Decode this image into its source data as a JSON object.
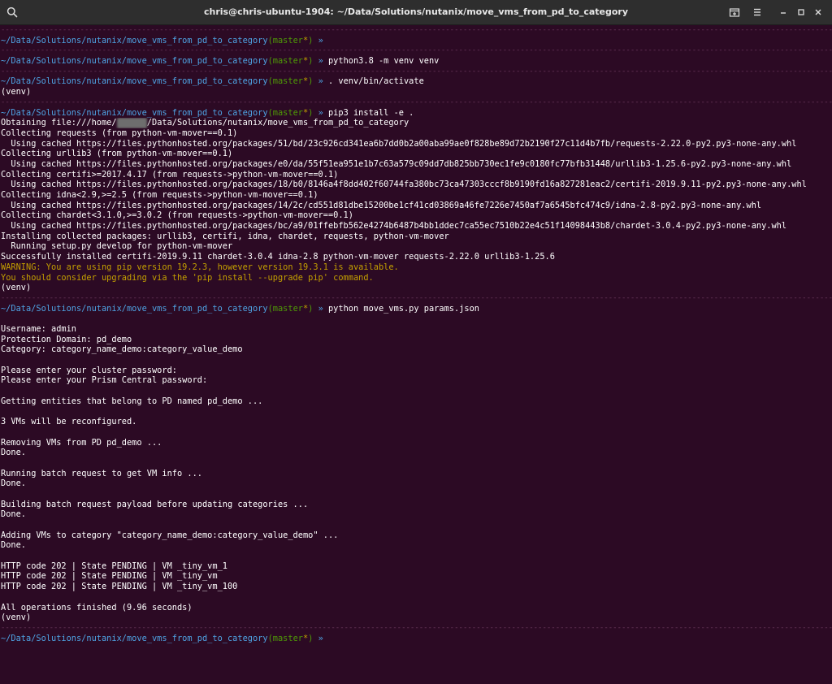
{
  "window": {
    "title": "chris@chris-ubuntu-1904: ~/Data/Solutions/nutanix/move_vms_from_pd_to_category",
    "icons": {
      "search": "search-icon",
      "new_tab": "new-tab-icon",
      "menu": "hamburger-menu-icon",
      "minimize": "minimize-icon",
      "maximize": "maximize-icon",
      "close": "close-icon"
    }
  },
  "colors": {
    "background": "#2c0a24",
    "foreground": "#ffffff",
    "prompt_path": "#4ea3e3",
    "prompt_branch": "#4e9a06",
    "warning": "#c4a000"
  },
  "prompt": {
    "path": "~/Data/Solutions/nutanix/move_vms_from_pd_to_category",
    "open_paren": "(",
    "branch": "master",
    "dirty": "*",
    "close_paren": ")",
    "arrow": " » "
  },
  "separator": "------------------------------------------------------------------------------------------------------------------------------------------------------------------------------------------------------------------------------------",
  "lines": [
    {
      "type": "sep"
    },
    {
      "type": "prompt",
      "cmd": ""
    },
    {
      "type": "sep"
    },
    {
      "type": "prompt",
      "cmd": "python3.8 -m venv venv"
    },
    {
      "type": "sep"
    },
    {
      "type": "prompt",
      "cmd": ". venv/bin/activate"
    },
    {
      "type": "text",
      "text": "(venv)"
    },
    {
      "type": "sep"
    },
    {
      "type": "prompt",
      "cmd": "pip3 install -e ."
    },
    {
      "type": "obtaining",
      "before": "Obtaining file:///home/",
      "redacted": "XXXXXX",
      "after": "/Data/Solutions/nutanix/move_vms_from_pd_to_category"
    },
    {
      "type": "text",
      "text": "Collecting requests (from python-vm-mover==0.1)"
    },
    {
      "type": "text",
      "text": "  Using cached https://files.pythonhosted.org/packages/51/bd/23c926cd341ea6b7dd0b2a00aba99ae0f828be89d72b2190f27c11d4b7fb/requests-2.22.0-py2.py3-none-any.whl"
    },
    {
      "type": "text",
      "text": "Collecting urllib3 (from python-vm-mover==0.1)"
    },
    {
      "type": "text",
      "text": "  Using cached https://files.pythonhosted.org/packages/e0/da/55f51ea951e1b7c63a579c09dd7db825bb730ec1fe9c0180fc77bfb31448/urllib3-1.25.6-py2.py3-none-any.whl"
    },
    {
      "type": "text",
      "text": "Collecting certifi>=2017.4.17 (from requests->python-vm-mover==0.1)"
    },
    {
      "type": "text",
      "text": "  Using cached https://files.pythonhosted.org/packages/18/b0/8146a4f8dd402f60744fa380bc73ca47303cccf8b9190fd16a827281eac2/certifi-2019.9.11-py2.py3-none-any.whl"
    },
    {
      "type": "text",
      "text": "Collecting idna<2.9,>=2.5 (from requests->python-vm-mover==0.1)"
    },
    {
      "type": "text",
      "text": "  Using cached https://files.pythonhosted.org/packages/14/2c/cd551d81dbe15200be1cf41cd03869a46fe7226e7450af7a6545bfc474c9/idna-2.8-py2.py3-none-any.whl"
    },
    {
      "type": "text",
      "text": "Collecting chardet<3.1.0,>=3.0.2 (from requests->python-vm-mover==0.1)"
    },
    {
      "type": "text",
      "text": "  Using cached https://files.pythonhosted.org/packages/bc/a9/01ffebfb562e4274b6487b4bb1ddec7ca55ec7510b22e4c51f14098443b8/chardet-3.0.4-py2.py3-none-any.whl"
    },
    {
      "type": "text",
      "text": "Installing collected packages: urllib3, certifi, idna, chardet, requests, python-vm-mover"
    },
    {
      "type": "text",
      "text": "  Running setup.py develop for python-vm-mover"
    },
    {
      "type": "text",
      "text": "Successfully installed certifi-2019.9.11 chardet-3.0.4 idna-2.8 python-vm-mover requests-2.22.0 urllib3-1.25.6"
    },
    {
      "type": "warn",
      "text": "WARNING: You are using pip version 19.2.3, however version 19.3.1 is available."
    },
    {
      "type": "warn",
      "text": "You should consider upgrading via the 'pip install --upgrade pip' command."
    },
    {
      "type": "text",
      "text": "(venv)"
    },
    {
      "type": "sep"
    },
    {
      "type": "prompt",
      "cmd": "python move_vms.py params.json"
    },
    {
      "type": "text",
      "text": ""
    },
    {
      "type": "text",
      "text": "Username: admin"
    },
    {
      "type": "text",
      "text": "Protection Domain: pd_demo"
    },
    {
      "type": "text",
      "text": "Category: category_name_demo:category_value_demo"
    },
    {
      "type": "text",
      "text": ""
    },
    {
      "type": "text",
      "text": "Please enter your cluster password:"
    },
    {
      "type": "text",
      "text": "Please enter your Prism Central password:"
    },
    {
      "type": "text",
      "text": ""
    },
    {
      "type": "text",
      "text": "Getting entities that belong to PD named pd_demo ..."
    },
    {
      "type": "text",
      "text": ""
    },
    {
      "type": "text",
      "text": "3 VMs will be reconfigured."
    },
    {
      "type": "text",
      "text": ""
    },
    {
      "type": "text",
      "text": "Removing VMs from PD pd_demo ..."
    },
    {
      "type": "text",
      "text": "Done."
    },
    {
      "type": "text",
      "text": ""
    },
    {
      "type": "text",
      "text": "Running batch request to get VM info ..."
    },
    {
      "type": "text",
      "text": "Done."
    },
    {
      "type": "text",
      "text": ""
    },
    {
      "type": "text",
      "text": "Building batch request payload before updating categories ..."
    },
    {
      "type": "text",
      "text": "Done."
    },
    {
      "type": "text",
      "text": ""
    },
    {
      "type": "text",
      "text": "Adding VMs to category \"category_name_demo:category_value_demo\" ..."
    },
    {
      "type": "text",
      "text": "Done."
    },
    {
      "type": "text",
      "text": ""
    },
    {
      "type": "text",
      "text": "HTTP code 202 | State PENDING | VM _tiny_vm_1"
    },
    {
      "type": "text",
      "text": "HTTP code 202 | State PENDING | VM _tiny_vm"
    },
    {
      "type": "text",
      "text": "HTTP code 202 | State PENDING | VM _tiny_vm_100"
    },
    {
      "type": "text",
      "text": ""
    },
    {
      "type": "text",
      "text": "All operations finished (9.96 seconds)"
    },
    {
      "type": "text",
      "text": "(venv)"
    },
    {
      "type": "sep"
    },
    {
      "type": "prompt",
      "cmd": ""
    }
  ]
}
